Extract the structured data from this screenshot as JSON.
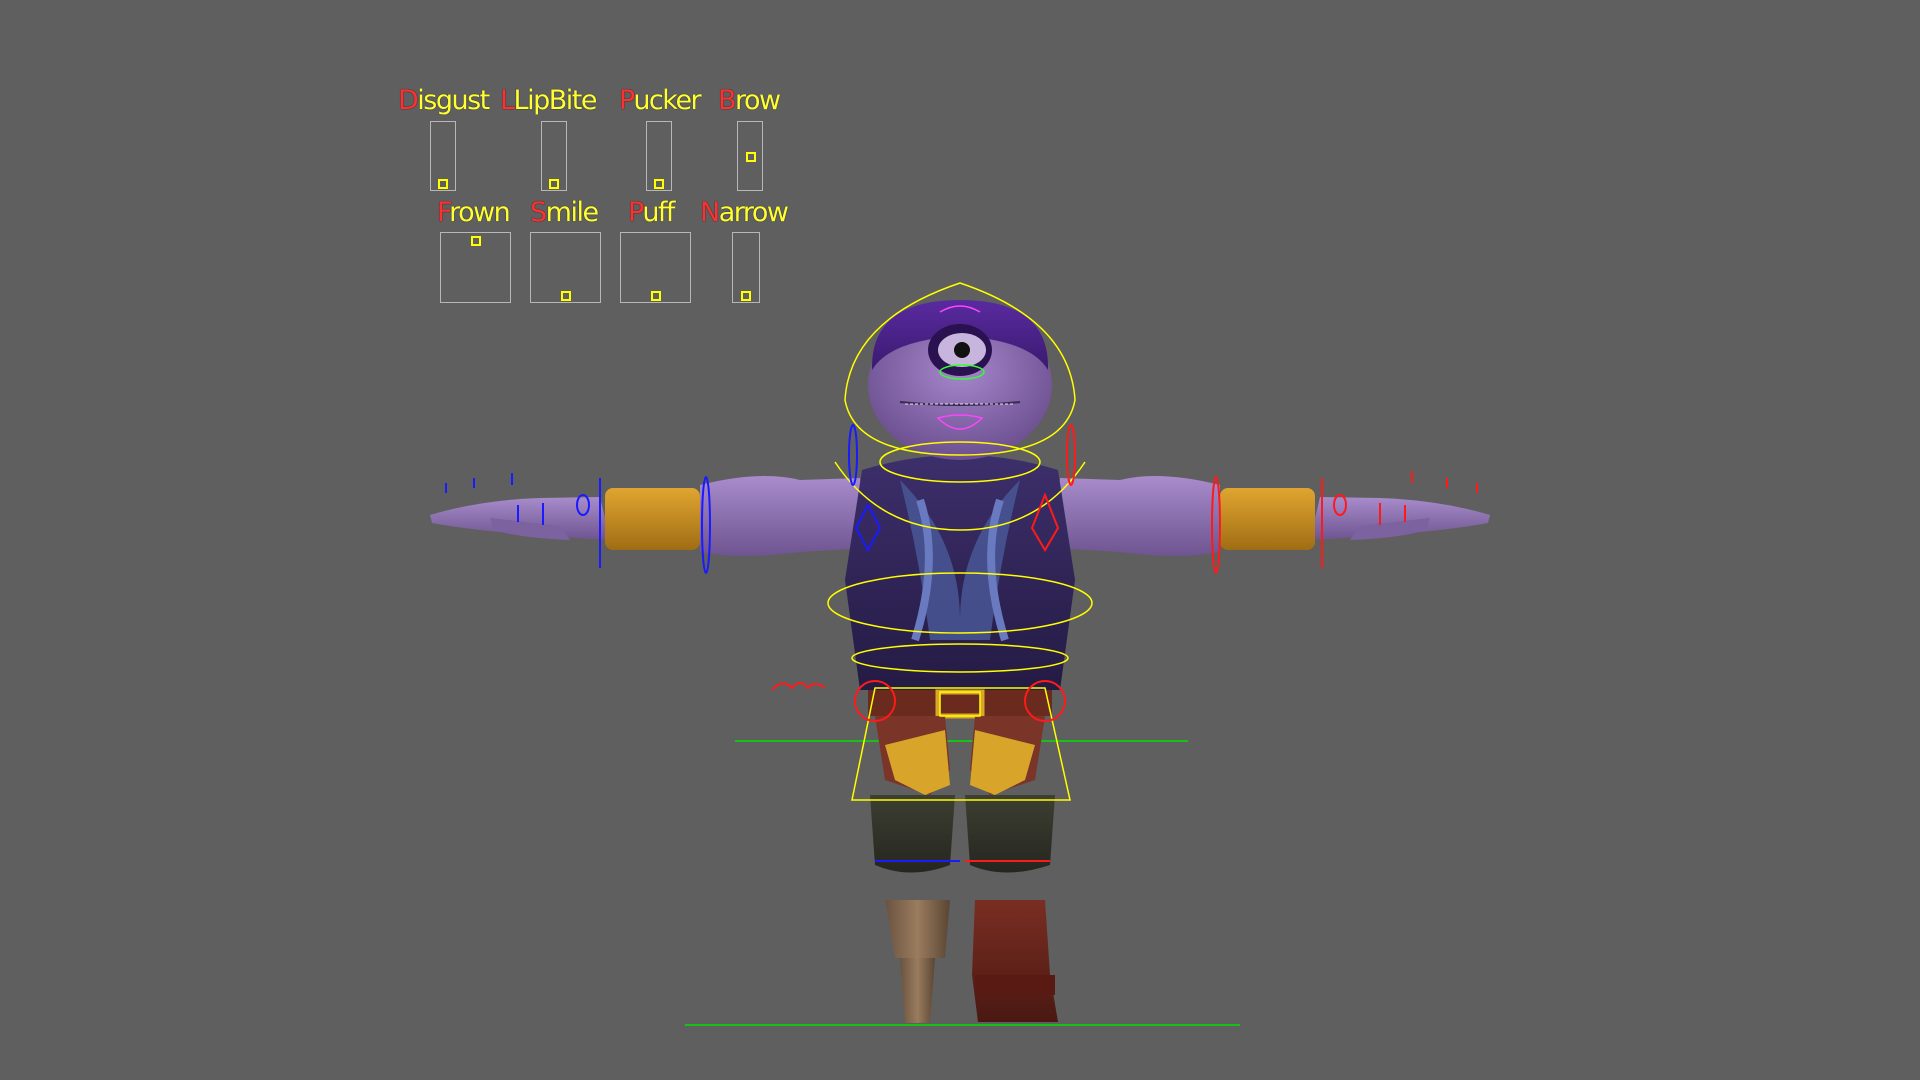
{
  "viewport": {
    "background": "#5f5f5f"
  },
  "face_controls": [
    {
      "name": "disgust",
      "initial": "D",
      "rest": "isgust",
      "value": 0.0
    },
    {
      "name": "lipbite",
      "initial": "L",
      "rest": "LipBite",
      "value": 0.0
    },
    {
      "name": "pucker",
      "initial": "P",
      "rest": "ucker",
      "value": 0.0
    },
    {
      "name": "brow",
      "initial": "B",
      "rest": "row",
      "value": 0.5
    },
    {
      "name": "frown",
      "initial": "F",
      "rest": "rown",
      "value": 1.0
    },
    {
      "name": "smile",
      "initial": "S",
      "rest": "mile",
      "value": 0.0
    },
    {
      "name": "puff",
      "initial": "P",
      "rest": "uff",
      "value": 0.0
    },
    {
      "name": "narrow",
      "initial": "N",
      "rest": "arrow",
      "value": 0.0
    }
  ],
  "colors": {
    "label_text": "#ffff33",
    "label_initial": "#ff3030",
    "slider_knob": "#ffff00",
    "control_center": "#ffff00",
    "control_left": "#0000ff",
    "control_right": "#ff1a1a",
    "ground_line": "#00e000",
    "skin": "#8f6fb5"
  }
}
